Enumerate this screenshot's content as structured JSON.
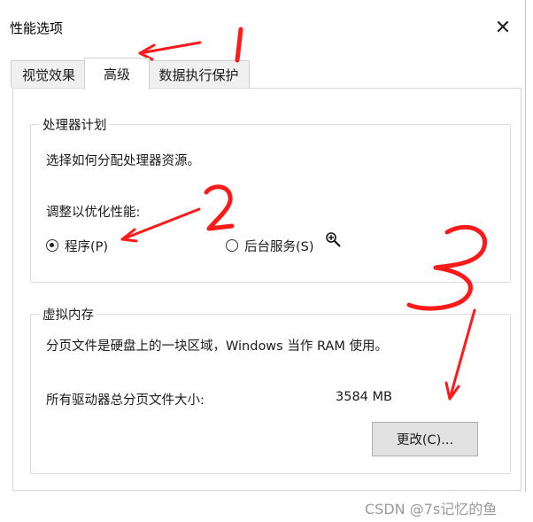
{
  "window": {
    "title": "性能选项",
    "close_glyph": "✕"
  },
  "tabs": [
    {
      "label": "视觉效果",
      "active": false
    },
    {
      "label": "高级",
      "active": true
    },
    {
      "label": "数据执行保护",
      "active": false
    }
  ],
  "processor_group": {
    "title": "处理器计划",
    "description": "选择如何分配处理器资源。",
    "optimize_label": "调整以优化性能:",
    "option_programs": "程序(P)",
    "option_services": "后台服务(S)",
    "selected": "programs"
  },
  "memory_group": {
    "title": "虚拟内存",
    "description": "分页文件是硬盘上的一块区域，Windows 当作 RAM 使用。",
    "total_label": "所有驱动器总分页文件大小:",
    "total_value": "3584 MB",
    "change_button": "更改(C)..."
  },
  "annotations": {
    "marks": [
      "1",
      "2",
      "3"
    ],
    "color": "#ff1a1a"
  },
  "cursor_icon": "zoom-cursor-icon",
  "watermark": "CSDN @7s记忆的鱼"
}
